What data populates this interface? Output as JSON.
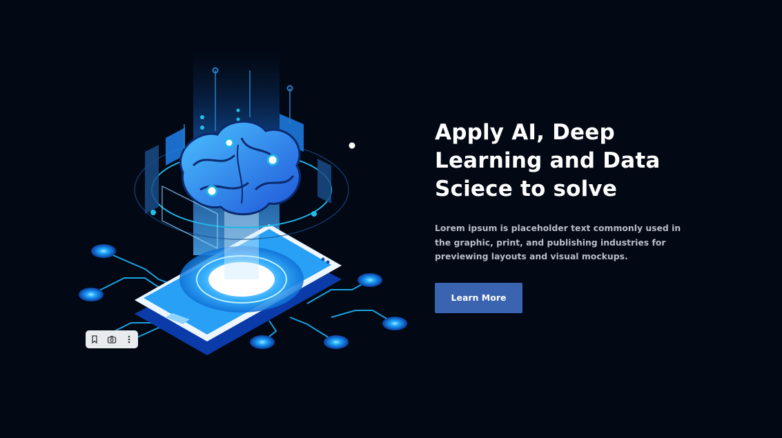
{
  "hero": {
    "headline_line1": "Apply AI, Deep",
    "headline_line2": "Learning and Data",
    "headline_line3": "Sciece to solve",
    "description": "Lorem ipsum is placeholder text commonly used in the graphic, print, and publishing industries for previewing layouts and visual mockups.",
    "cta_label": "Learn More"
  },
  "image_toolbar": {
    "icons": [
      "bookmark-icon",
      "camera-icon",
      "more-vertical-icon"
    ]
  },
  "colors": {
    "background": "#020814",
    "accent_blue": "#3a63b0",
    "glow_blue": "#1e90ff",
    "text_white": "#ffffff",
    "text_gray": "#b9bec8"
  }
}
